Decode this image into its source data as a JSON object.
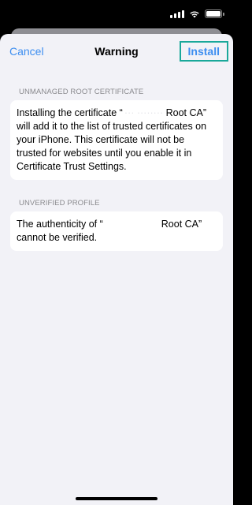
{
  "nav": {
    "cancel": "Cancel",
    "title": "Warning",
    "install": "Install"
  },
  "sections": [
    {
      "header": "UNMANAGED ROOT CERTIFICATE",
      "body_prefix": "Installing the certificate “",
      "body_redacted": " ··· ········",
      "body_suffix": " Root CA” will add it to the list of trusted certificates on your iPhone. This certificate will not be trusted for websites until you enable it in Certificate Trust Settings."
    },
    {
      "header": "UNVERIFIED PROFILE",
      "body_prefix": "The authenticity of “",
      "body_suffix": "Root CA” cannot be verified."
    }
  ],
  "colors": {
    "accent": "#3d8ef0",
    "highlight_border": "#1aa89a",
    "background": "#f2f2f7"
  },
  "icons": [
    "signal-icon",
    "wifi-icon",
    "battery-icon"
  ]
}
